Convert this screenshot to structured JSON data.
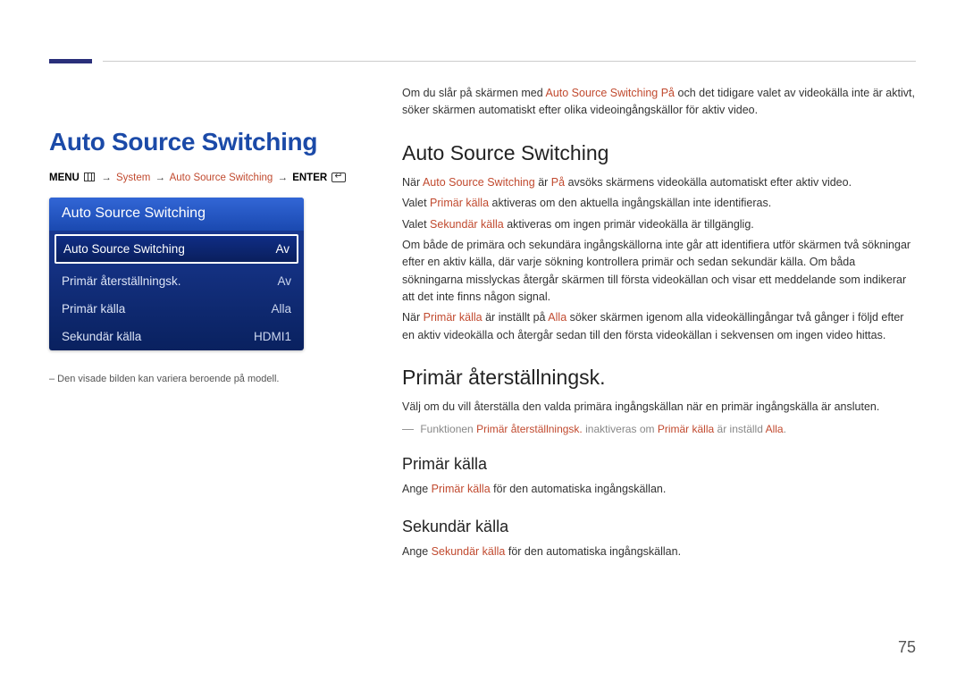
{
  "page_title": "Auto Source Switching",
  "breadcrumb": {
    "menu": "MENU",
    "system": "System",
    "auto_src": "Auto Source Switching",
    "enter": "ENTER"
  },
  "panel": {
    "header": "Auto Source Switching",
    "rows": [
      {
        "label": "Auto Source Switching",
        "value": "Av",
        "selected": true
      },
      {
        "label": "Primär återställningsk.",
        "value": "Av",
        "selected": false
      },
      {
        "label": "Primär källa",
        "value": "Alla",
        "selected": false
      },
      {
        "label": "Sekundär källa",
        "value": "HDMI1",
        "selected": false
      }
    ]
  },
  "left_footnote": "– Den visade bilden kan variera beroende på modell.",
  "intro": {
    "p1_a": "Om du slår på skärmen med ",
    "p1_hl": "Auto Source Switching På",
    "p1_b": " och det tidigare valet av videokälla inte är aktivt, söker skärmen automatiskt efter olika videoingångskällor för aktiv video."
  },
  "sections": {
    "ass": {
      "title": "Auto Source Switching",
      "p1_a": "När ",
      "p1_hl1": "Auto Source Switching",
      "p1_b": " är ",
      "p1_hl2": "På",
      "p1_c": " avsöks skärmens videokälla automatiskt efter aktiv video.",
      "p2_a": "Valet ",
      "p2_hl": "Primär källa",
      "p2_b": " aktiveras om den aktuella ingångskällan inte identifieras.",
      "p3_a": "Valet ",
      "p3_hl": "Sekundär källa",
      "p3_b": " aktiveras om ingen primär videokälla är tillgänglig.",
      "p4": "Om både de primära och sekundära ingångskällorna inte går att identifiera utför skärmen två sökningar efter en aktiv källa, där varje sökning kontrollera primär och sedan sekundär källa. Om båda sökningarna misslyckas återgår skärmen till första videokällan och visar ett meddelande som indikerar att det inte finns någon signal.",
      "p5_a": "När ",
      "p5_hl1": "Primär källa",
      "p5_b": " är inställt på ",
      "p5_hl2": "Alla",
      "p5_c": " söker skärmen igenom alla videokällingångar två gånger i följd efter en aktiv videokälla och återgår sedan till den första videokällan i sekvensen om ingen video hittas."
    },
    "primar_ater": {
      "title": "Primär återställningsk.",
      "p1": "Välj om du vill återställa den valda primära ingångskällan när en primär ingångskälla är ansluten.",
      "note_a": "Funktionen ",
      "note_hl1": "Primär återställningsk.",
      "note_b": " inaktiveras om ",
      "note_hl2": "Primär källa",
      "note_c": " är inställd ",
      "note_hl3": "Alla",
      "note_d": "."
    },
    "primar_kalla": {
      "title": "Primär källa",
      "p1_a": "Ange ",
      "p1_hl": "Primär källa",
      "p1_b": " för den automatiska ingångskällan."
    },
    "sekundar_kalla": {
      "title": "Sekundär källa",
      "p1_a": "Ange ",
      "p1_hl": "Sekundär källa",
      "p1_b": " för den automatiska ingångskällan."
    }
  },
  "page_number": "75"
}
